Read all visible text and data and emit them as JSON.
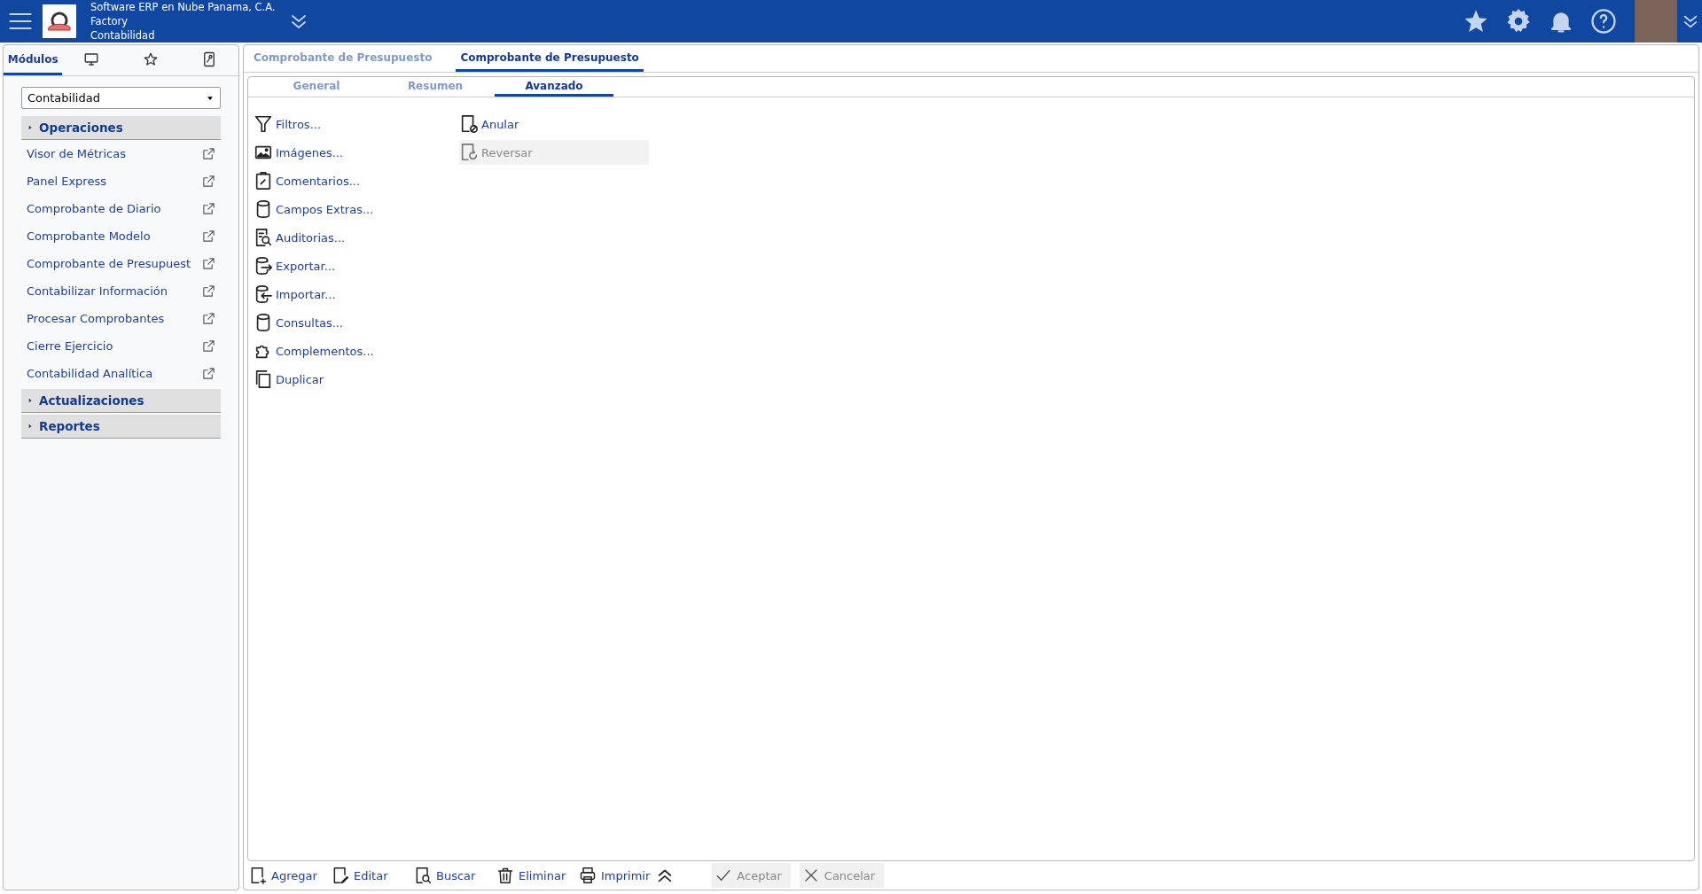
{
  "header": {
    "company": "Software ERP en Nube Panama, C.A.",
    "branch": "Factory",
    "module": "Contabilidad"
  },
  "sidebar": {
    "tabs": [
      {
        "kind": "text",
        "label": "Módulos",
        "selected": true
      },
      {
        "kind": "icon",
        "selected": false
      },
      {
        "kind": "icon",
        "selected": false
      },
      {
        "kind": "icon",
        "selected": false
      }
    ],
    "module_select": {
      "value": "Contabilidad"
    },
    "groups": [
      {
        "label": "Operaciones",
        "items": [
          {
            "label": "Visor de Métricas"
          },
          {
            "label": "Panel Express"
          },
          {
            "label": "Comprobante de Diario"
          },
          {
            "label": "Comprobante Modelo"
          },
          {
            "label": "Comprobante de Presupuest"
          },
          {
            "label": "Contabilizar Información"
          },
          {
            "label": "Procesar Comprobantes"
          },
          {
            "label": "Cierre Ejercicio"
          },
          {
            "label": "Contabilidad Analítica"
          }
        ]
      },
      {
        "label": "Actualizaciones"
      },
      {
        "label": "Reportes"
      }
    ]
  },
  "main": {
    "tabs": [
      {
        "label": "Comprobante de Presupuesto",
        "selected": false
      },
      {
        "label": "Comprobante de Presupuesto",
        "selected": true
      }
    ],
    "subtabs": [
      {
        "label": "General",
        "selected": false
      },
      {
        "label": "Resumen",
        "selected": false
      },
      {
        "label": "Avanzado",
        "selected": true
      }
    ],
    "actions_left": [
      {
        "label": "Filtros...",
        "disabled": false
      },
      {
        "label": "Imágenes...",
        "disabled": false
      },
      {
        "label": "Comentarios...",
        "disabled": false
      },
      {
        "label": "Campos Extras...",
        "disabled": false
      },
      {
        "label": "Auditorias...",
        "disabled": false
      },
      {
        "label": "Exportar...",
        "disabled": false
      },
      {
        "label": "Importar...",
        "disabled": false
      },
      {
        "label": "Consultas...",
        "disabled": false
      },
      {
        "label": "Complementos...",
        "disabled": false
      },
      {
        "label": "Duplicar",
        "disabled": false
      }
    ],
    "actions_right": [
      {
        "label": "Anular",
        "disabled": false
      },
      {
        "label": "Reversar",
        "disabled": true
      }
    ],
    "toolbar": [
      {
        "label": "Agregar",
        "disabled": false
      },
      {
        "label": "Editar",
        "disabled": false
      },
      {
        "label": "Buscar",
        "disabled": false
      },
      {
        "label": "Eliminar",
        "disabled": false
      },
      {
        "label": "Imprimir",
        "disabled": false
      }
    ],
    "confirm_buttons": [
      {
        "label": "Aceptar",
        "disabled": true
      },
      {
        "label": "Cancelar",
        "disabled": true
      }
    ]
  }
}
